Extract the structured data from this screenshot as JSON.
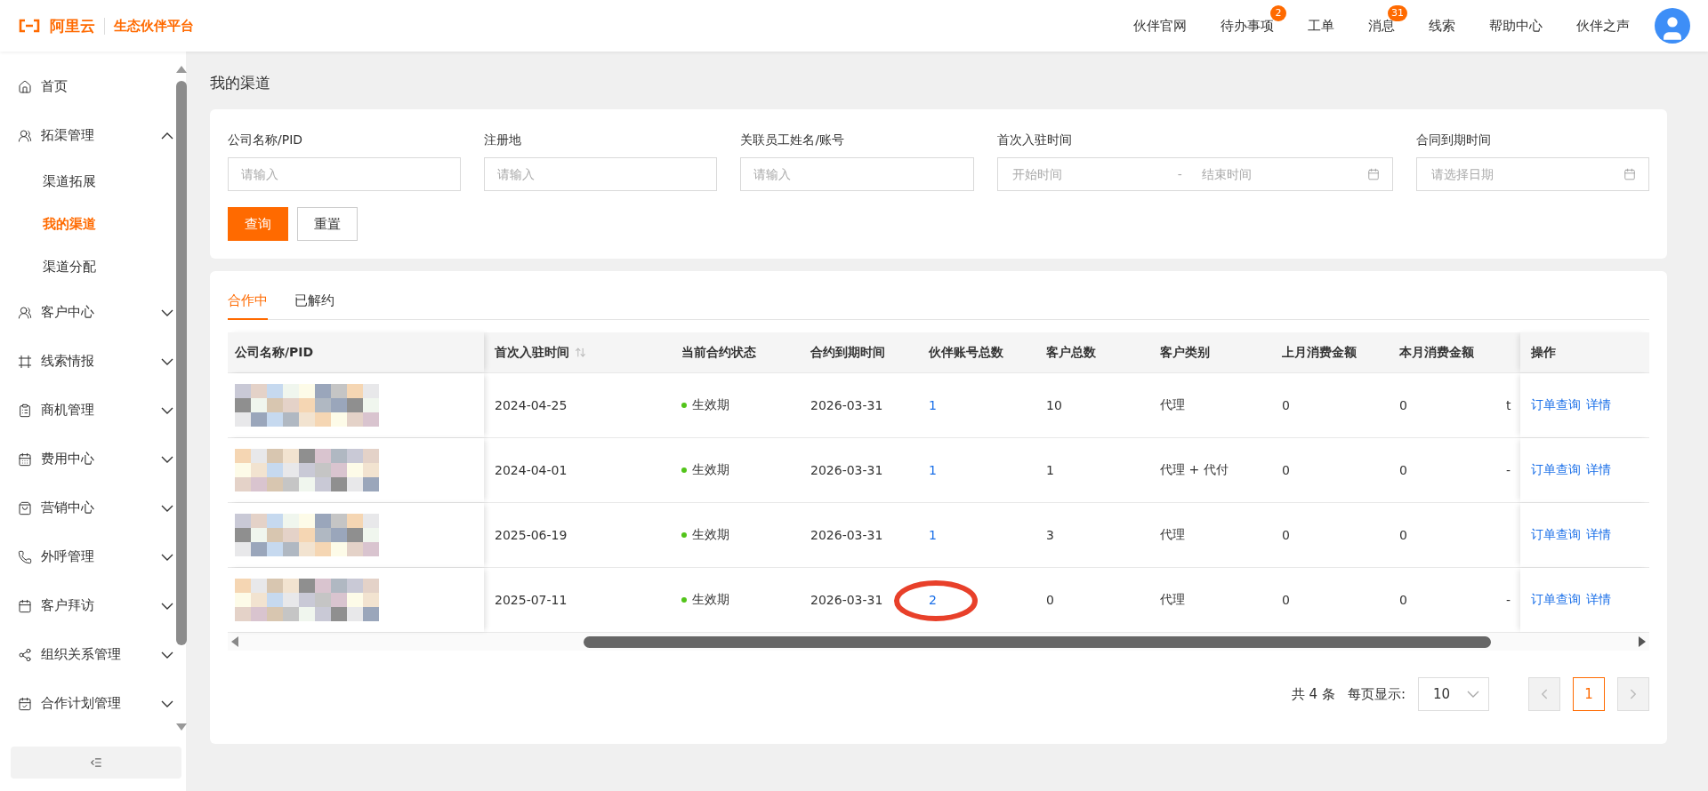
{
  "header": {
    "logo_text": "阿里云",
    "platform": "生态伙伴平台",
    "nav": [
      {
        "label": "伙伴官网"
      },
      {
        "label": "待办事项",
        "badge": "2"
      },
      {
        "label": "工单"
      },
      {
        "label": "消息",
        "badge": "31"
      },
      {
        "label": "线索"
      },
      {
        "label": "帮助中心"
      },
      {
        "label": "伙伴之声"
      }
    ]
  },
  "sidebar": {
    "items": [
      {
        "label": "首页",
        "selected": false
      },
      {
        "label": "拓渠管理",
        "expanded": true,
        "children": [
          {
            "label": "渠道拓展",
            "selected": false
          },
          {
            "label": "我的渠道",
            "selected": true
          },
          {
            "label": "渠道分配",
            "selected": false
          }
        ]
      },
      {
        "label": "客户中心",
        "expanded": false
      },
      {
        "label": "线索情报",
        "expanded": false
      },
      {
        "label": "商机管理",
        "expanded": false
      },
      {
        "label": "费用中心",
        "expanded": false
      },
      {
        "label": "营销中心",
        "expanded": false
      },
      {
        "label": "外呼管理",
        "expanded": false
      },
      {
        "label": "客户拜访",
        "expanded": false
      },
      {
        "label": "组织关系管理",
        "expanded": false
      },
      {
        "label": "合作计划管理",
        "expanded": false
      }
    ]
  },
  "page_title": "我的渠道",
  "filters": [
    {
      "kind": "text",
      "label": "公司名称/PID",
      "placeholder": "请输入"
    },
    {
      "kind": "text",
      "label": "注册地",
      "placeholder": "请输入"
    },
    {
      "kind": "text",
      "label": "关联员工姓名/账号",
      "placeholder": "请输入"
    },
    {
      "kind": "range",
      "label": "首次入驻时间",
      "placeholder": "开始时间",
      "placeholder_end": "结束时间",
      "separator": "-"
    },
    {
      "kind": "date",
      "label": "合同到期时间",
      "placeholder": "请选择日期"
    }
  ],
  "buttons": [
    {
      "label": "查询",
      "primary": true
    },
    {
      "label": "重置",
      "primary": false
    }
  ],
  "tabs": [
    {
      "label": "合作中",
      "selected": true
    },
    {
      "label": "已解约",
      "selected": false
    }
  ],
  "table": {
    "columns": [
      {
        "label": "公司名称/PID"
      },
      {
        "label": "首次入驻时间",
        "sortable": true
      },
      {
        "label": "当前合约状态"
      },
      {
        "label": "合约到期时间"
      },
      {
        "label": "伙伴账号总数"
      },
      {
        "label": "客户总数"
      },
      {
        "label": "客户类别"
      },
      {
        "label": "上月消费金额"
      },
      {
        "label": "本月消费金额"
      },
      {
        "label": "操作"
      }
    ],
    "rows": [
      {
        "first_join": "2024-04-25",
        "status": {
          "text": "生效期",
          "color": "#52c41a"
        },
        "expire": "2026-03-31",
        "partner_accounts": "1",
        "circled": false,
        "customers": "10",
        "customer_type": "代理",
        "last_month": "0",
        "this_month": "0",
        "column_10": "t",
        "actions": [
          "订单查询",
          "详情"
        ]
      },
      {
        "first_join": "2024-04-01",
        "status": {
          "text": "生效期",
          "color": "#52c41a"
        },
        "expire": "2026-03-31",
        "partner_accounts": "1",
        "circled": false,
        "customers": "1",
        "customer_type": "代理 + 代付",
        "last_month": "0",
        "this_month": "0",
        "column_10": "-",
        "actions": [
          "订单查询",
          "详情"
        ]
      },
      {
        "first_join": "2025-06-19",
        "status": {
          "text": "生效期",
          "color": "#52c41a"
        },
        "expire": "2026-03-31",
        "partner_accounts": "1",
        "circled": false,
        "customers": "3",
        "customer_type": "代理",
        "last_month": "0",
        "this_month": "0",
        "actions": [
          "订单查询",
          "详情"
        ]
      },
      {
        "first_join": "2025-07-11",
        "status": {
          "text": "生效期",
          "color": "#52c41a"
        },
        "expire": "2026-03-31",
        "partner_accounts": "2",
        "circled": true,
        "customers": "0",
        "customer_type": "代理",
        "last_month": "0",
        "this_month": "0",
        "column_10": "-",
        "actions": [
          "订单查询",
          "详情"
        ]
      }
    ]
  },
  "pagination": {
    "total": "共 4 条",
    "page_size_label": "每页显示:",
    "page_size": "10",
    "pages": [
      {
        "label": "1",
        "selected": true
      }
    ]
  }
}
